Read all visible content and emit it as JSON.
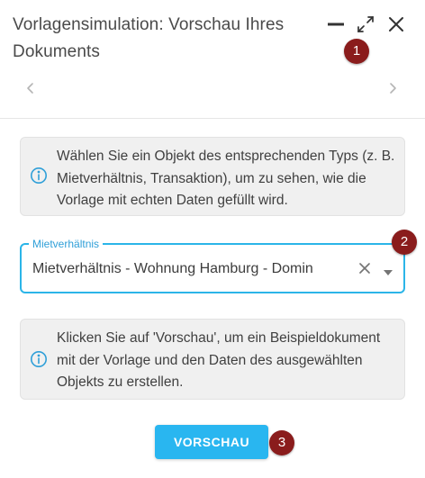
{
  "dialog": {
    "title": "Vorlagensimulation: Vorschau Ihres Dokuments"
  },
  "info_select_object": "Wählen Sie ein Objekt des entsprechenden Typs (z. B. Mietverhältnis, Transaktion), um zu sehen, wie die Vorlage mit echten Daten gefüllt wird.",
  "object_select": {
    "label": "Mietverhältnis",
    "value": "Mietverhältnis - Wohnung Hamburg -  Domin"
  },
  "info_preview": "Klicken Sie auf 'Vorschau', um ein Beispieldokument mit der Vorlage und den Daten des ausgewählten Objekts zu erstellen.",
  "preview_button_label": "VORSCHAU",
  "markers": [
    "1",
    "2",
    "3"
  ],
  "colors": {
    "accent": "#29b6f0",
    "marker": "#8a1c1c",
    "info_bg": "#f0f0f0"
  },
  "icons": {
    "minimize": "minimize-icon",
    "maximize": "maximize-icon",
    "close": "close-icon",
    "prev": "chevron-left-icon",
    "next": "chevron-right-icon",
    "info": "info-icon",
    "clear": "clear-icon",
    "dropdown": "dropdown-arrow-icon"
  }
}
